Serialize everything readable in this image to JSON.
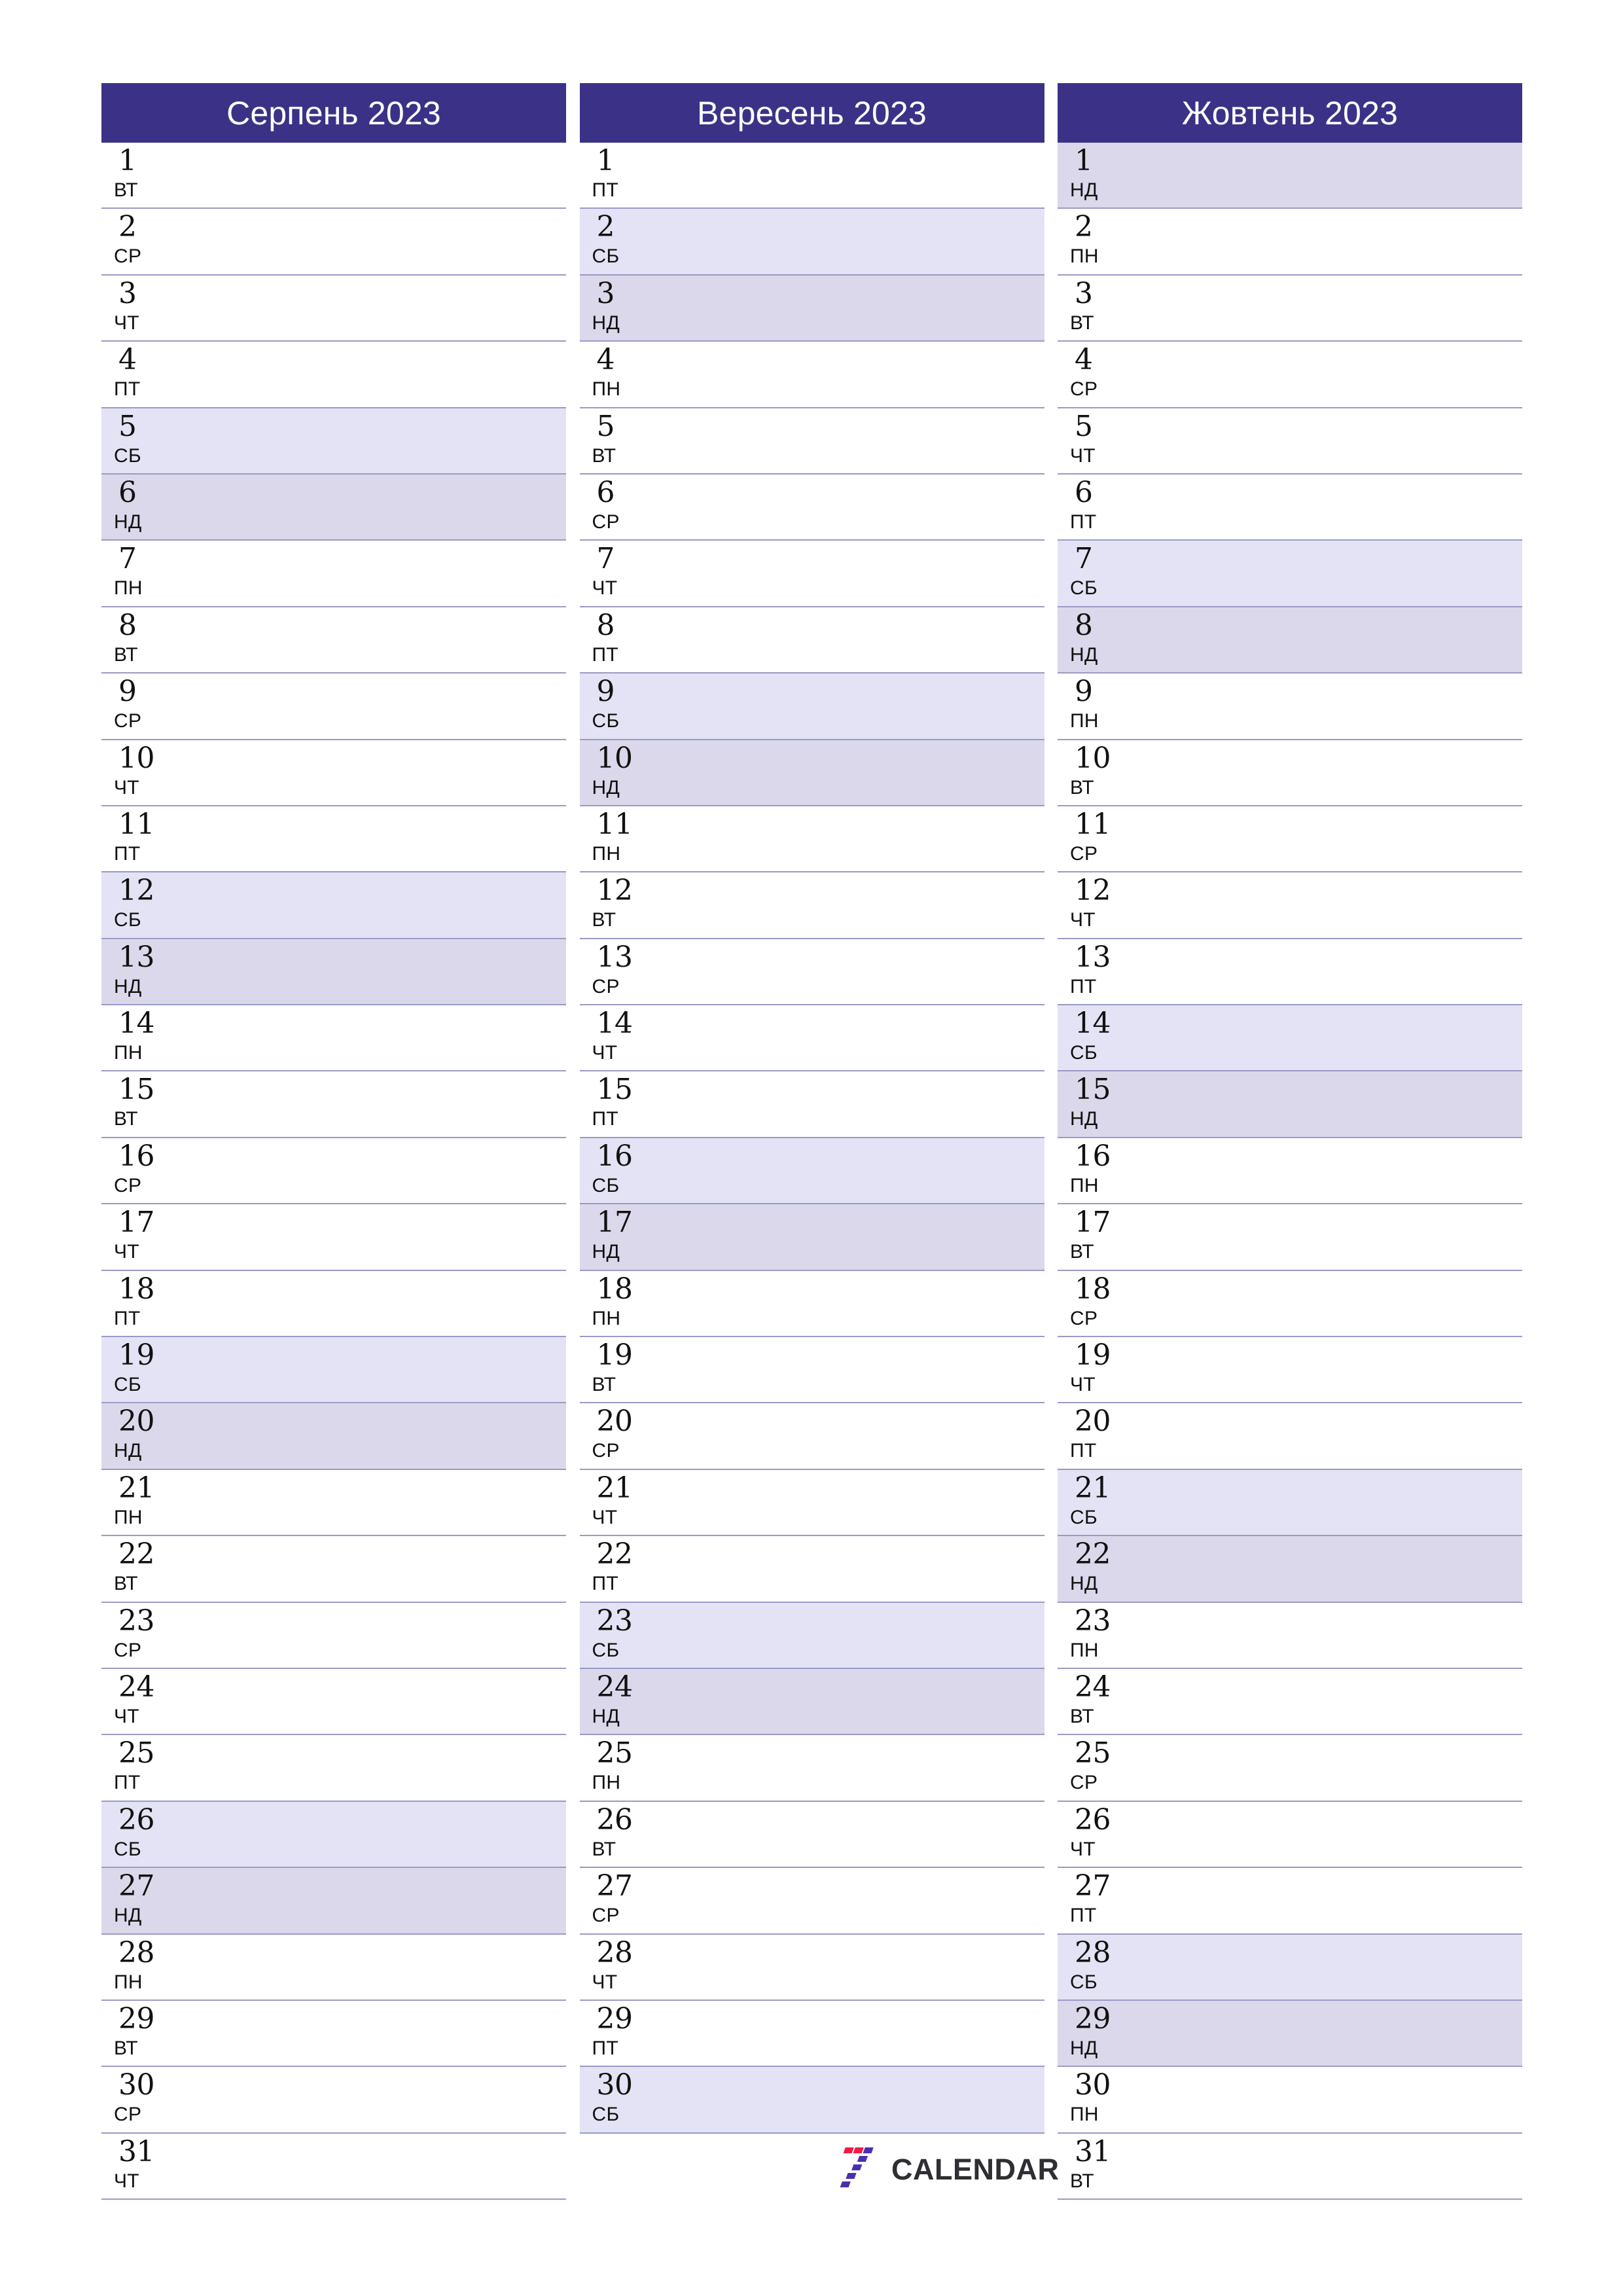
{
  "page": {
    "type": "printable-monthly-planner",
    "locale": "uk",
    "orientation": "portrait",
    "columns": 3
  },
  "colors": {
    "header_background": "#3b3287",
    "header_text": "#ffffff",
    "saturday_background": "#e3e3f5",
    "sunday_background": "#dcd8eb",
    "weekday_background": "#ffffff",
    "row_divider": "#9a9ac6",
    "day_text": "#111111",
    "logo_red": "#f01b43",
    "logo_purple": "#4b2fb0",
    "logo_wordmark": "#2e2e33"
  },
  "weekday_labels": {
    "mon": "ПН",
    "tue": "ВТ",
    "wed": "СР",
    "thu": "ЧТ",
    "fri": "ПТ",
    "sat": "СБ",
    "sun": "НД"
  },
  "brand": {
    "logo_mark_name": "seven-calendar-logo",
    "wordmark": "CALENDAR"
  },
  "months": [
    {
      "title": "Серпень 2023",
      "month_name": "Серпень",
      "year": "2023",
      "days_count": 31,
      "days": [
        {
          "num": "1",
          "wd": "ВТ",
          "kind": "weekday"
        },
        {
          "num": "2",
          "wd": "СР",
          "kind": "weekday"
        },
        {
          "num": "3",
          "wd": "ЧТ",
          "kind": "weekday"
        },
        {
          "num": "4",
          "wd": "ПТ",
          "kind": "weekday"
        },
        {
          "num": "5",
          "wd": "СБ",
          "kind": "sat"
        },
        {
          "num": "6",
          "wd": "НД",
          "kind": "sun"
        },
        {
          "num": "7",
          "wd": "ПН",
          "kind": "weekday"
        },
        {
          "num": "8",
          "wd": "ВТ",
          "kind": "weekday"
        },
        {
          "num": "9",
          "wd": "СР",
          "kind": "weekday"
        },
        {
          "num": "10",
          "wd": "ЧТ",
          "kind": "weekday"
        },
        {
          "num": "11",
          "wd": "ПТ",
          "kind": "weekday"
        },
        {
          "num": "12",
          "wd": "СБ",
          "kind": "sat"
        },
        {
          "num": "13",
          "wd": "НД",
          "kind": "sun"
        },
        {
          "num": "14",
          "wd": "ПН",
          "kind": "weekday"
        },
        {
          "num": "15",
          "wd": "ВТ",
          "kind": "weekday"
        },
        {
          "num": "16",
          "wd": "СР",
          "kind": "weekday"
        },
        {
          "num": "17",
          "wd": "ЧТ",
          "kind": "weekday"
        },
        {
          "num": "18",
          "wd": "ПТ",
          "kind": "weekday"
        },
        {
          "num": "19",
          "wd": "СБ",
          "kind": "sat"
        },
        {
          "num": "20",
          "wd": "НД",
          "kind": "sun"
        },
        {
          "num": "21",
          "wd": "ПН",
          "kind": "weekday"
        },
        {
          "num": "22",
          "wd": "ВТ",
          "kind": "weekday"
        },
        {
          "num": "23",
          "wd": "СР",
          "kind": "weekday"
        },
        {
          "num": "24",
          "wd": "ЧТ",
          "kind": "weekday"
        },
        {
          "num": "25",
          "wd": "ПТ",
          "kind": "weekday"
        },
        {
          "num": "26",
          "wd": "СБ",
          "kind": "sat"
        },
        {
          "num": "27",
          "wd": "НД",
          "kind": "sun"
        },
        {
          "num": "28",
          "wd": "ПН",
          "kind": "weekday"
        },
        {
          "num": "29",
          "wd": "ВТ",
          "kind": "weekday"
        },
        {
          "num": "30",
          "wd": "СР",
          "kind": "weekday"
        },
        {
          "num": "31",
          "wd": "ЧТ",
          "kind": "weekday"
        }
      ]
    },
    {
      "title": "Вересень 2023",
      "month_name": "Вересень",
      "year": "2023",
      "days_count": 30,
      "days": [
        {
          "num": "1",
          "wd": "ПТ",
          "kind": "weekday"
        },
        {
          "num": "2",
          "wd": "СБ",
          "kind": "sat"
        },
        {
          "num": "3",
          "wd": "НД",
          "kind": "sun"
        },
        {
          "num": "4",
          "wd": "ПН",
          "kind": "weekday"
        },
        {
          "num": "5",
          "wd": "ВТ",
          "kind": "weekday"
        },
        {
          "num": "6",
          "wd": "СР",
          "kind": "weekday"
        },
        {
          "num": "7",
          "wd": "ЧТ",
          "kind": "weekday"
        },
        {
          "num": "8",
          "wd": "ПТ",
          "kind": "weekday"
        },
        {
          "num": "9",
          "wd": "СБ",
          "kind": "sat"
        },
        {
          "num": "10",
          "wd": "НД",
          "kind": "sun"
        },
        {
          "num": "11",
          "wd": "ПН",
          "kind": "weekday"
        },
        {
          "num": "12",
          "wd": "ВТ",
          "kind": "weekday"
        },
        {
          "num": "13",
          "wd": "СР",
          "kind": "weekday"
        },
        {
          "num": "14",
          "wd": "ЧТ",
          "kind": "weekday"
        },
        {
          "num": "15",
          "wd": "ПТ",
          "kind": "weekday"
        },
        {
          "num": "16",
          "wd": "СБ",
          "kind": "sat"
        },
        {
          "num": "17",
          "wd": "НД",
          "kind": "sun"
        },
        {
          "num": "18",
          "wd": "ПН",
          "kind": "weekday"
        },
        {
          "num": "19",
          "wd": "ВТ",
          "kind": "weekday"
        },
        {
          "num": "20",
          "wd": "СР",
          "kind": "weekday"
        },
        {
          "num": "21",
          "wd": "ЧТ",
          "kind": "weekday"
        },
        {
          "num": "22",
          "wd": "ПТ",
          "kind": "weekday"
        },
        {
          "num": "23",
          "wd": "СБ",
          "kind": "sat"
        },
        {
          "num": "24",
          "wd": "НД",
          "kind": "sun"
        },
        {
          "num": "25",
          "wd": "ПН",
          "kind": "weekday"
        },
        {
          "num": "26",
          "wd": "ВТ",
          "kind": "weekday"
        },
        {
          "num": "27",
          "wd": "СР",
          "kind": "weekday"
        },
        {
          "num": "28",
          "wd": "ЧТ",
          "kind": "weekday"
        },
        {
          "num": "29",
          "wd": "ПТ",
          "kind": "weekday"
        },
        {
          "num": "30",
          "wd": "СБ",
          "kind": "sat"
        }
      ]
    },
    {
      "title": "Жовтень 2023",
      "month_name": "Жовтень",
      "year": "2023",
      "days_count": 31,
      "days": [
        {
          "num": "1",
          "wd": "НД",
          "kind": "sun"
        },
        {
          "num": "2",
          "wd": "ПН",
          "kind": "weekday"
        },
        {
          "num": "3",
          "wd": "ВТ",
          "kind": "weekday"
        },
        {
          "num": "4",
          "wd": "СР",
          "kind": "weekday"
        },
        {
          "num": "5",
          "wd": "ЧТ",
          "kind": "weekday"
        },
        {
          "num": "6",
          "wd": "ПТ",
          "kind": "weekday"
        },
        {
          "num": "7",
          "wd": "СБ",
          "kind": "sat"
        },
        {
          "num": "8",
          "wd": "НД",
          "kind": "sun"
        },
        {
          "num": "9",
          "wd": "ПН",
          "kind": "weekday"
        },
        {
          "num": "10",
          "wd": "ВТ",
          "kind": "weekday"
        },
        {
          "num": "11",
          "wd": "СР",
          "kind": "weekday"
        },
        {
          "num": "12",
          "wd": "ЧТ",
          "kind": "weekday"
        },
        {
          "num": "13",
          "wd": "ПТ",
          "kind": "weekday"
        },
        {
          "num": "14",
          "wd": "СБ",
          "kind": "sat"
        },
        {
          "num": "15",
          "wd": "НД",
          "kind": "sun"
        },
        {
          "num": "16",
          "wd": "ПН",
          "kind": "weekday"
        },
        {
          "num": "17",
          "wd": "ВТ",
          "kind": "weekday"
        },
        {
          "num": "18",
          "wd": "СР",
          "kind": "weekday"
        },
        {
          "num": "19",
          "wd": "ЧТ",
          "kind": "weekday"
        },
        {
          "num": "20",
          "wd": "ПТ",
          "kind": "weekday"
        },
        {
          "num": "21",
          "wd": "СБ",
          "kind": "sat"
        },
        {
          "num": "22",
          "wd": "НД",
          "kind": "sun"
        },
        {
          "num": "23",
          "wd": "ПН",
          "kind": "weekday"
        },
        {
          "num": "24",
          "wd": "ВТ",
          "kind": "weekday"
        },
        {
          "num": "25",
          "wd": "СР",
          "kind": "weekday"
        },
        {
          "num": "26",
          "wd": "ЧТ",
          "kind": "weekday"
        },
        {
          "num": "27",
          "wd": "ПТ",
          "kind": "weekday"
        },
        {
          "num": "28",
          "wd": "СБ",
          "kind": "sat"
        },
        {
          "num": "29",
          "wd": "НД",
          "kind": "sun"
        },
        {
          "num": "30",
          "wd": "ПН",
          "kind": "weekday"
        },
        {
          "num": "31",
          "wd": "ВТ",
          "kind": "weekday"
        }
      ]
    }
  ]
}
